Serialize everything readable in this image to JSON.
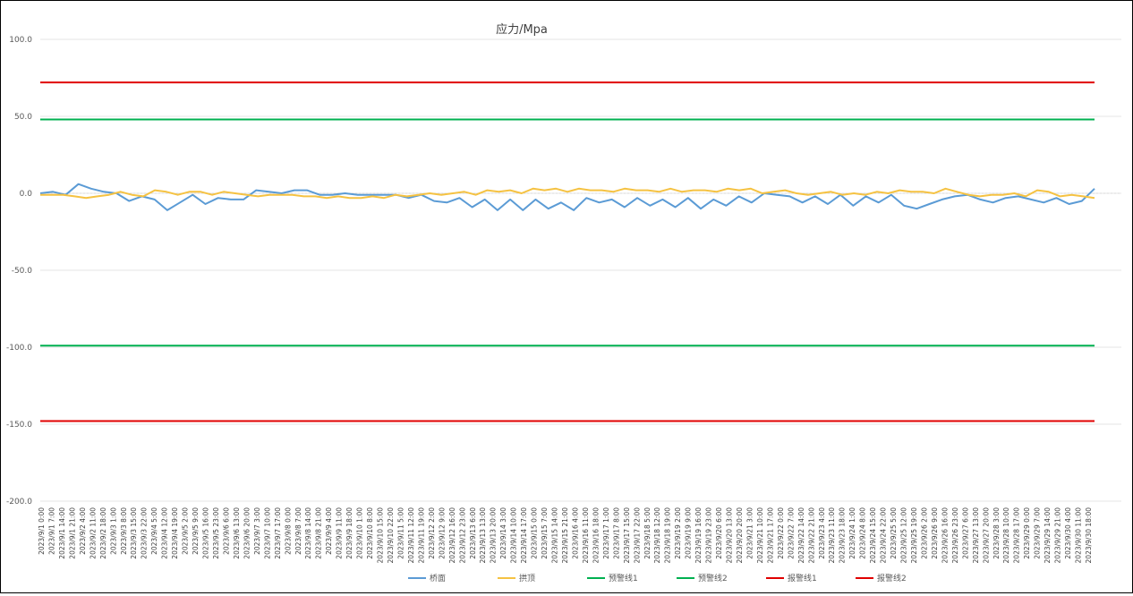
{
  "chart_data": {
    "type": "line",
    "title": "应力/Mpa",
    "xlabel": "",
    "ylabel": "",
    "ylim": [
      -200,
      100
    ],
    "yticks": [
      "100.0",
      "50.0",
      "0.0",
      "-50.0",
      "-100.0",
      "-150.0",
      "-200.0"
    ],
    "grid": true,
    "legend_position": "bottom",
    "x_tick_labels": [
      "2023/9/1 0:00",
      "2023/9/1 7:00",
      "2023/9/1 14:00",
      "2023/9/1 21:00",
      "2023/9/2 4:00",
      "2023/9/2 11:00",
      "2023/9/2 18:00",
      "2023/9/3 1:00",
      "2023/9/3 8:00",
      "2023/9/3 15:00",
      "2023/9/3 22:00",
      "2023/9/4 5:00",
      "2023/9/4 12:00",
      "2023/9/4 19:00",
      "2023/9/5 2:00",
      "2023/9/5 9:00",
      "2023/9/5 16:00",
      "2023/9/5 23:00",
      "2023/9/6 6:00",
      "2023/9/6 13:00",
      "2023/9/6 20:00",
      "2023/9/7 3:00",
      "2023/9/7 10:00",
      "2023/9/7 17:00",
      "2023/9/8 0:00",
      "2023/9/8 7:00",
      "2023/9/8 14:00",
      "2023/9/8 21:00",
      "2023/9/9 4:00",
      "2023/9/9 11:00",
      "2023/9/9 18:00",
      "2023/9/10 1:00",
      "2023/9/10 8:00",
      "2023/9/10 15:00",
      "2023/9/10 22:00",
      "2023/9/11 5:00",
      "2023/9/11 12:00",
      "2023/9/11 19:00",
      "2023/9/12 2:00",
      "2023/9/12 9:00",
      "2023/9/12 16:00",
      "2023/9/12 23:00",
      "2023/9/13 6:00",
      "2023/9/13 13:00",
      "2023/9/13 20:00",
      "2023/9/14 3:00",
      "2023/9/14 10:00",
      "2023/9/14 17:00",
      "2023/9/15 0:00",
      "2023/9/15 7:00",
      "2023/9/15 14:00",
      "2023/9/15 21:00",
      "2023/9/16 4:00",
      "2023/9/16 11:00",
      "2023/9/16 18:00",
      "2023/9/17 1:00",
      "2023/9/17 8:00",
      "2023/9/17 15:00",
      "2023/9/17 22:00",
      "2023/9/18 5:00",
      "2023/9/18 12:00",
      "2023/9/18 19:00",
      "2023/9/19 2:00",
      "2023/9/19 9:00",
      "2023/9/19 16:00",
      "2023/9/19 23:00",
      "2023/9/20 6:00",
      "2023/9/20 13:00",
      "2023/9/20 20:00",
      "2023/9/21 3:00",
      "2023/9/21 10:00",
      "2023/9/21 17:00",
      "2023/9/22 0:00",
      "2023/9/22 7:00",
      "2023/9/22 14:00",
      "2023/9/22 21:00",
      "2023/9/23 4:00",
      "2023/9/23 11:00",
      "2023/9/23 18:00",
      "2023/9/24 1:00",
      "2023/9/24 8:00",
      "2023/9/24 15:00",
      "2023/9/24 22:00",
      "2023/9/25 5:00",
      "2023/9/25 12:00",
      "2023/9/25 19:00",
      "2023/9/26 2:00",
      "2023/9/26 9:00",
      "2023/9/26 16:00",
      "2023/9/26 23:00",
      "2023/9/27 6:00",
      "2023/9/27 13:00",
      "2023/9/27 20:00",
      "2023/9/28 3:00",
      "2023/9/28 10:00",
      "2023/9/28 17:00",
      "2023/9/29 0:00",
      "2023/9/29 7:00",
      "2023/9/29 14:00",
      "2023/9/29 21:00",
      "2023/9/30 4:00",
      "2023/9/30 11:00",
      "2023/9/30 18:00"
    ],
    "series": [
      {
        "name": "桥面",
        "color": "#5b9bd5",
        "values": [
          0,
          1,
          -1,
          6,
          3,
          1,
          0,
          -5,
          -2,
          -4,
          -11,
          -6,
          -1,
          -7,
          -3,
          -4,
          -4,
          2,
          1,
          0,
          2,
          2,
          -1,
          -1,
          0,
          -1,
          -1,
          -1,
          -1,
          -3,
          -1,
          -5,
          -6,
          -3,
          -9,
          -4,
          -11,
          -4,
          -11,
          -4,
          -10,
          -6,
          -11,
          -3,
          -6,
          -4,
          -9,
          -3,
          -8,
          -4,
          -9,
          -3,
          -10,
          -4,
          -8,
          -2,
          -6,
          0,
          -1,
          -2,
          -6,
          -2,
          -7,
          -1,
          -8,
          -2,
          -6,
          -1,
          -8,
          -10,
          -7,
          -4,
          -2,
          -1,
          -4,
          -6,
          -3,
          -2,
          -4,
          -6,
          -3,
          -7,
          -5,
          3
        ]
      },
      {
        "name": "拱顶",
        "color": "#f5c242",
        "values": [
          -1,
          -1,
          -1,
          -2,
          -3,
          -2,
          -1,
          1,
          -1,
          -2,
          2,
          1,
          -1,
          1,
          1,
          -1,
          1,
          0,
          -1,
          -2,
          -1,
          -1,
          -1,
          -2,
          -2,
          -3,
          -2,
          -3,
          -3,
          -2,
          -3,
          -1,
          -2,
          -1,
          0,
          -1,
          0,
          1,
          -1,
          2,
          1,
          2,
          0,
          3,
          2,
          3,
          1,
          3,
          2,
          2,
          1,
          3,
          2,
          2,
          1,
          3,
          1,
          2,
          2,
          1,
          3,
          2,
          3,
          0,
          1,
          2,
          0,
          -1,
          0,
          1,
          -1,
          0,
          -1,
          1,
          0,
          2,
          1,
          1,
          0,
          3,
          1,
          -1,
          -2,
          -1,
          -1,
          0,
          -2,
          2,
          1,
          -2,
          -1,
          -2,
          -3
        ]
      },
      {
        "name": "预警线1",
        "color": "#00b050",
        "value": 48
      },
      {
        "name": "预警线2",
        "color": "#00b050",
        "value": -99
      },
      {
        "name": "报警线1",
        "color": "#e00000",
        "value": 72
      },
      {
        "name": "报警线2",
        "color": "#e00000",
        "value": -148
      }
    ]
  }
}
